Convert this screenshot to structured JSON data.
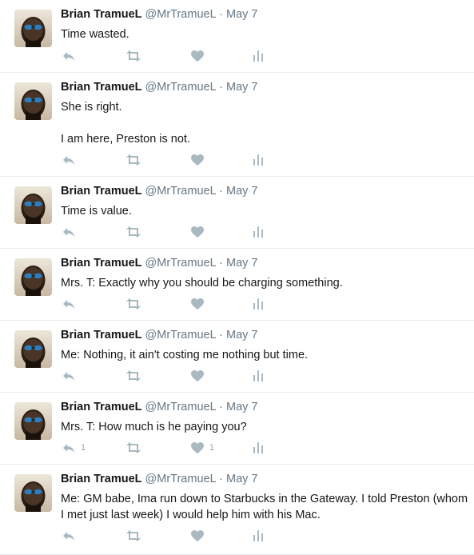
{
  "icons": {
    "reply": "reply-icon",
    "retweet": "retweet-icon",
    "like": "heart-icon",
    "stats": "analytics-icon"
  },
  "colors": {
    "action_icon": "#aab8c2",
    "handle": "#657786",
    "divider": "#e6ecf0"
  },
  "tweets": [
    {
      "name": "Brian TramueL",
      "handle": "@MrTramueL",
      "sep": "·",
      "date": "May 7",
      "text": [
        "Time wasted."
      ],
      "reply_count": "",
      "like_count": ""
    },
    {
      "name": "Brian TramueL",
      "handle": "@MrTramueL",
      "sep": "·",
      "date": "May 7",
      "text": [
        "She is right.",
        "",
        "I am here, Preston is not."
      ],
      "reply_count": "",
      "like_count": ""
    },
    {
      "name": "Brian TramueL",
      "handle": "@MrTramueL",
      "sep": "·",
      "date": "May 7",
      "text": [
        "Time is value."
      ],
      "reply_count": "",
      "like_count": ""
    },
    {
      "name": "Brian TramueL",
      "handle": "@MrTramueL",
      "sep": "·",
      "date": "May 7",
      "text": [
        "Mrs. T: Exactly why you should be charging something."
      ],
      "reply_count": "",
      "like_count": ""
    },
    {
      "name": "Brian TramueL",
      "handle": "@MrTramueL",
      "sep": "·",
      "date": "May 7",
      "text": [
        "Me: Nothing, it ain't costing me nothing but time."
      ],
      "reply_count": "",
      "like_count": ""
    },
    {
      "name": "Brian TramueL",
      "handle": "@MrTramueL",
      "sep": "·",
      "date": "May 7",
      "text": [
        "Mrs. T: How much is he paying you?"
      ],
      "reply_count": "1",
      "like_count": "1"
    },
    {
      "name": "Brian TramueL",
      "handle": "@MrTramueL",
      "sep": "·",
      "date": "May 7",
      "text": [
        "Me: GM babe, Ima run down to Starbucks in the Gateway. I told Preston (whom I met just last week) I would help him with his Mac."
      ],
      "reply_count": "",
      "like_count": ""
    }
  ]
}
